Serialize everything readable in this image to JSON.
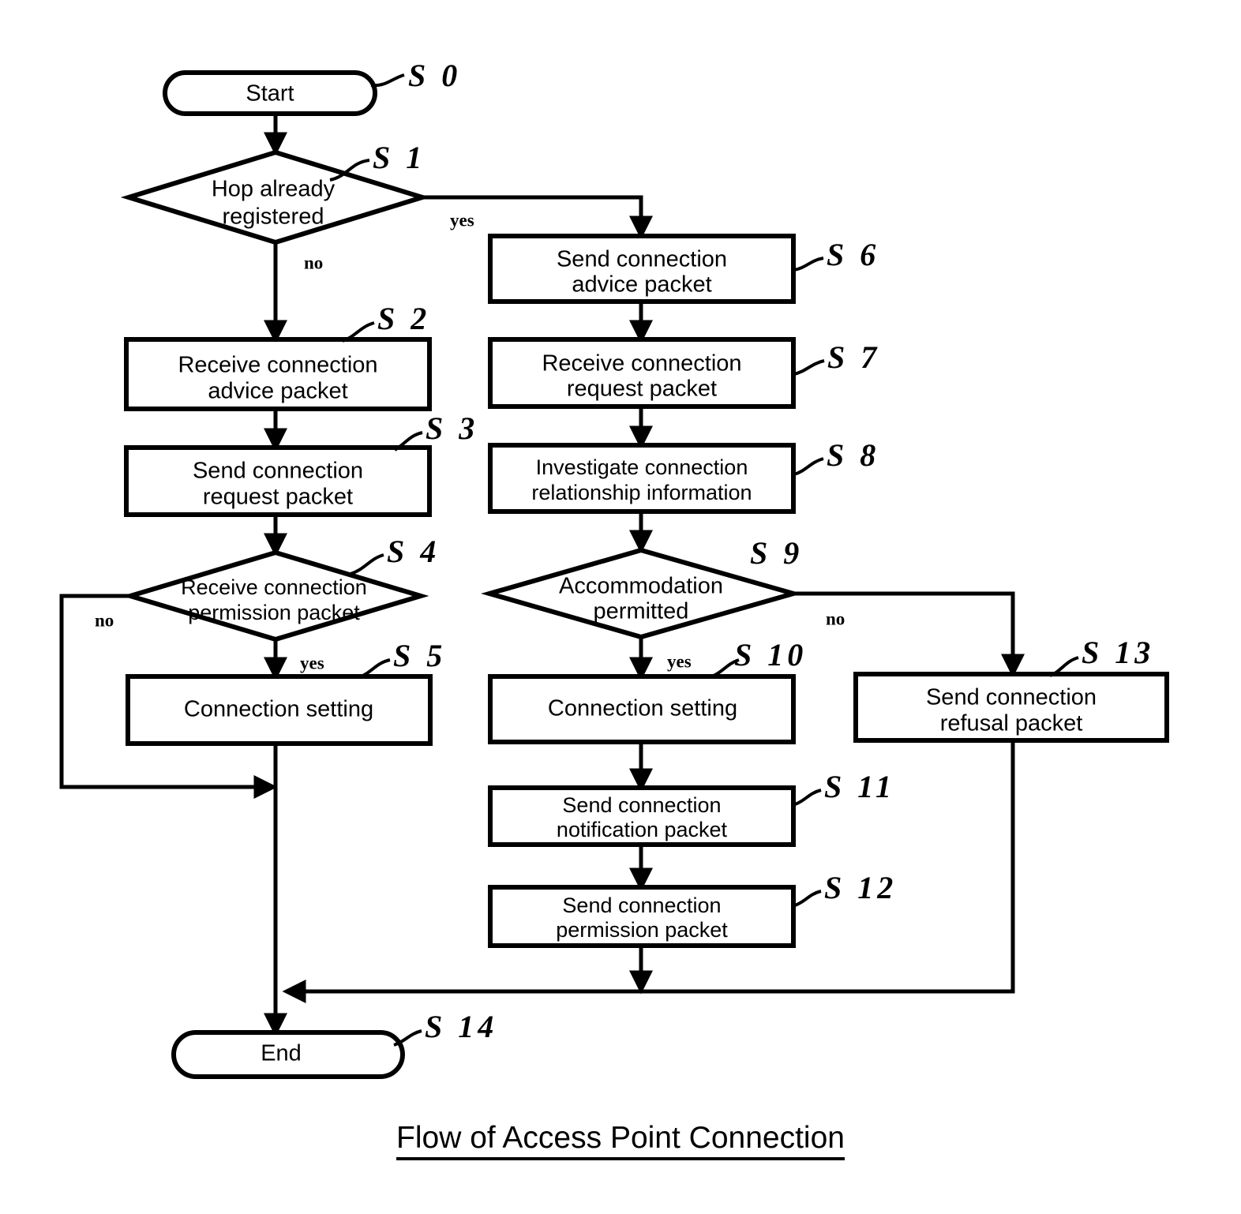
{
  "diagram": {
    "caption": "Flow of Access Point Connection",
    "nodes": {
      "start": {
        "label": "Start",
        "tag": "S 0"
      },
      "s1": {
        "label_line1": "Hop already",
        "label_line2": "registered",
        "tag": "S 1"
      },
      "s2": {
        "label_line1": "Receive connection",
        "label_line2": "advice packet",
        "tag": "S 2"
      },
      "s3": {
        "label_line1": "Send connection",
        "label_line2": "request packet",
        "tag": "S 3"
      },
      "s4": {
        "label_line1": "Receive connection",
        "label_line2": "permission packet",
        "tag": "S 4"
      },
      "s5": {
        "label": "Connection setting",
        "tag": "S 5"
      },
      "s6": {
        "label_line1": "Send connection",
        "label_line2": "advice packet",
        "tag": "S 6"
      },
      "s7": {
        "label_line1": "Receive connection",
        "label_line2": "request packet",
        "tag": "S 7"
      },
      "s8": {
        "label_line1": "Investigate connection",
        "label_line2": "relationship information",
        "tag": "S 8"
      },
      "s9": {
        "label_line1": "Accommodation",
        "label_line2": "permitted",
        "tag": "S 9"
      },
      "s10": {
        "label": "Connection setting",
        "tag": "S 10"
      },
      "s11": {
        "label_line1": "Send connection",
        "label_line2": "notification packet",
        "tag": "S 11"
      },
      "s12": {
        "label_line1": "Send connection",
        "label_line2": "permission packet",
        "tag": "S 12"
      },
      "s13": {
        "label_line1": "Send connection",
        "label_line2": "refusal packet",
        "tag": "S 13"
      },
      "end": {
        "label": "End",
        "tag": "S 14"
      }
    },
    "edge_labels": {
      "s1_yes": "yes",
      "s1_no": "no",
      "s4_no": "no",
      "s4_yes": "yes",
      "s9_yes": "yes",
      "s9_no": "no"
    },
    "colors": {
      "stroke": "#000000",
      "fill": "#ffffff",
      "text": "#000000"
    }
  }
}
